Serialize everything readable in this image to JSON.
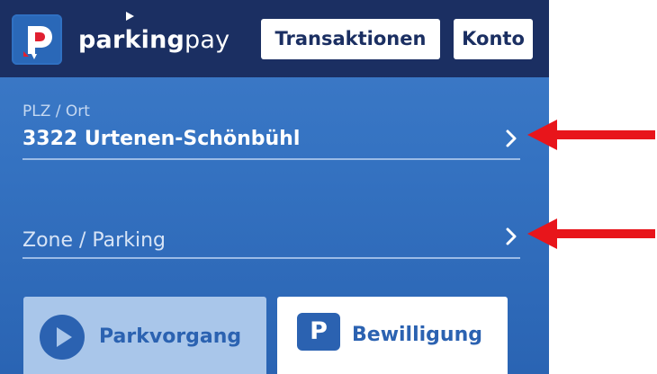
{
  "header": {
    "brand_bold": "parking",
    "brand_regular": "pay",
    "transactions_label": "Transaktionen",
    "account_label": "Konto"
  },
  "location_field": {
    "label": "PLZ / Ort",
    "value": "3322 Urtenen-Schönbühl"
  },
  "zone_field": {
    "placeholder": "Zone / Parking"
  },
  "actions": {
    "parking_label": "Parkvorgang",
    "permit_label": "Bewilligung",
    "permit_icon_letter": "P"
  },
  "colors": {
    "header_bg": "#1b2f62",
    "content_bg": "#3573c2",
    "accent_blue": "#2b62b1",
    "annotation_arrow": "#e8151b"
  },
  "icons": [
    "parkingpay-logo-icon",
    "chevron-right-icon",
    "play-circle-icon",
    "parking-p-icon",
    "red-arrow-icon"
  ]
}
